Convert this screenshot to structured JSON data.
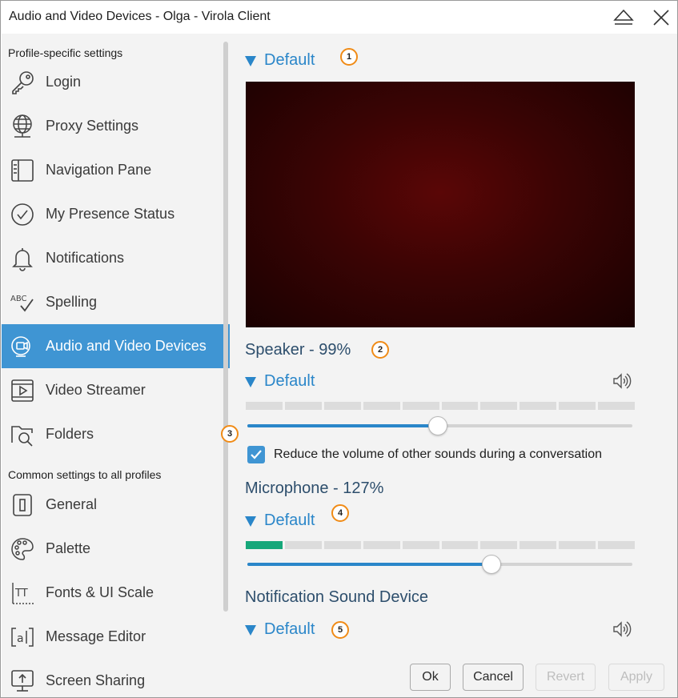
{
  "window": {
    "title": "Audio and Video Devices - Olga - Virola Client"
  },
  "sidebar": {
    "profile_header": "Profile-specific settings",
    "common_header": "Common settings to all profiles",
    "profile_items": [
      {
        "label": "Login",
        "icon": "key-icon"
      },
      {
        "label": "Proxy Settings",
        "icon": "globe-network-icon"
      },
      {
        "label": "Navigation Pane",
        "icon": "navigation-pane-icon"
      },
      {
        "label": "My Presence Status",
        "icon": "check-circle-icon"
      },
      {
        "label": "Notifications",
        "icon": "bell-icon"
      },
      {
        "label": "Spelling",
        "icon": "spellcheck-icon"
      },
      {
        "label": "Audio and Video Devices",
        "icon": "webcam-icon",
        "active": true
      },
      {
        "label": "Video Streamer",
        "icon": "video-play-icon"
      },
      {
        "label": "Folders",
        "icon": "folder-search-icon"
      }
    ],
    "common_items": [
      {
        "label": "General",
        "icon": "general-icon"
      },
      {
        "label": "Palette",
        "icon": "palette-icon"
      },
      {
        "label": "Fonts & UI Scale",
        "icon": "font-scale-icon"
      },
      {
        "label": "Message Editor",
        "icon": "message-editor-icon"
      },
      {
        "label": "Screen Sharing",
        "icon": "screen-share-icon"
      }
    ]
  },
  "main": {
    "camera": {
      "device": "Default",
      "badge": "1"
    },
    "speaker": {
      "title": "Speaker - 99%",
      "badge": "2",
      "device": "Default",
      "slider_badge": "3",
      "level_percent": 99,
      "meter_active_segments": 0,
      "meter_segments": 10
    },
    "reduce_volume": {
      "label": "Reduce the volume of other sounds during a conversation",
      "checked": true
    },
    "microphone": {
      "title": "Microphone - 127%",
      "device": "Default",
      "badge": "4",
      "level_percent": 127,
      "meter_active_segments": 1,
      "meter_segments": 10
    },
    "notification": {
      "title": "Notification Sound Device",
      "device": "Default",
      "badge": "5"
    }
  },
  "buttons": {
    "ok": "Ok",
    "cancel": "Cancel",
    "revert": "Revert",
    "apply": "Apply"
  },
  "colors": {
    "accent": "#3f95d3",
    "link": "#2a86c9",
    "badge_border": "#f08b16",
    "meter_on": "#16a77a"
  }
}
